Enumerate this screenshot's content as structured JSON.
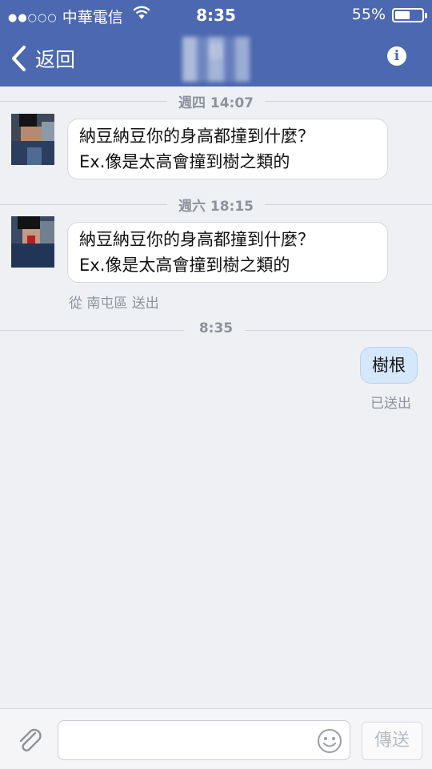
{
  "status_bar": {
    "signal_dots": "●●○○○",
    "carrier": "中華電信",
    "time": "8:35",
    "battery_percent": "55%",
    "battery_level": 0.55
  },
  "nav": {
    "back_label": "返回",
    "contact_name": "蔡",
    "info_icon": "i"
  },
  "messages": [
    {
      "divider": "週四 14:07",
      "direction": "incoming",
      "lines": [
        "納豆納豆你的身高都撞到什麼？",
        "Ex.像是太高會撞到樹之類的"
      ]
    },
    {
      "divider": "週六 18:15",
      "direction": "incoming",
      "lines": [
        "納豆納豆你的身高都撞到什麼？",
        "Ex.像是太高會撞到樹之類的"
      ],
      "location_note": "從 南屯區 送出"
    },
    {
      "divider": "8:35",
      "direction": "outgoing",
      "text": "樹根",
      "status": "已送出"
    }
  ],
  "composer": {
    "placeholder": "",
    "send_label": "傳送",
    "attach_icon": "paperclip-icon",
    "emoji_icon": "smiley-icon"
  },
  "colors": {
    "header": "#4b68b0",
    "background": "#eff0f4",
    "outgoing_bubble": "#d5e7fb"
  }
}
